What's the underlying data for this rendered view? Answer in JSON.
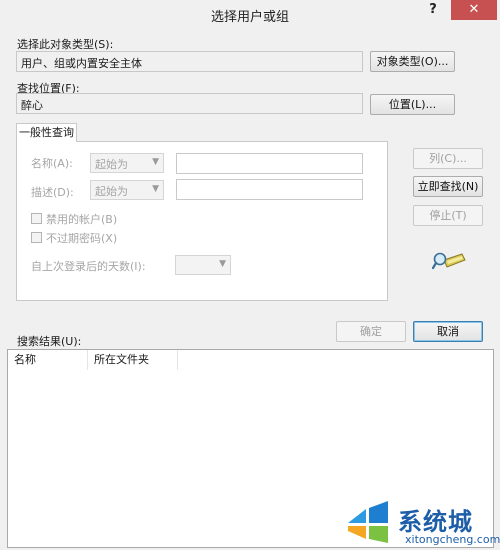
{
  "window": {
    "title": "选择用户或组",
    "help_label": "?",
    "close_label": "✕"
  },
  "object_type": {
    "label": "选择此对象类型(S):",
    "value": "用户、组或内置安全主体",
    "button": "对象类型(O)..."
  },
  "location": {
    "label": "查找位置(F):",
    "value": "醉心",
    "button": "位置(L)..."
  },
  "tab": {
    "label": "一般性查询"
  },
  "query": {
    "name_label": "名称(A):",
    "name_mode": "起始为",
    "desc_label": "描述(D):",
    "desc_mode": "起始为",
    "disabled_accounts": "禁用的帐户(B)",
    "nonexpiring_pwd": "不过期密码(X)",
    "days_label": "自上次登录后的天数(I):"
  },
  "side_buttons": {
    "columns": "列(C)...",
    "find_now": "立即查找(N)",
    "stop": "停止(T)"
  },
  "actions": {
    "ok": "确定",
    "cancel": "取消"
  },
  "results": {
    "label": "搜索结果(U):",
    "columns": [
      "名称",
      "所在文件夹"
    ]
  },
  "watermark": {
    "text": "系统城",
    "url": "xitongcheng.com"
  },
  "colors": {
    "close_red": "#c75050",
    "watermark_blue": "#1e5ea8"
  }
}
